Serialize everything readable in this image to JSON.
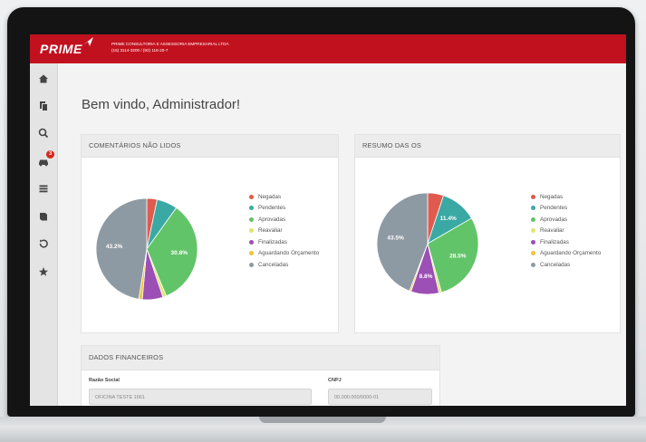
{
  "header": {
    "logo_text": "PRIME",
    "company_name": "PRIME CONSULTORIA E ASSESSORIA EMPRESARIAL LTDA",
    "company_phone": "(15) 3114-3200 / (92) 116-20-7",
    "brand_color": "#c2111e"
  },
  "sidebar": {
    "items": [
      {
        "icon": "home-icon"
      },
      {
        "icon": "documents-icon"
      },
      {
        "icon": "search-icon"
      },
      {
        "icon": "car-icon",
        "badge": "3"
      },
      {
        "icon": "list-icon"
      },
      {
        "icon": "book-icon"
      },
      {
        "icon": "history-icon"
      },
      {
        "icon": "star-icon"
      }
    ]
  },
  "welcome": "Bem vindo, Administrador!",
  "panels": {
    "comments": {
      "title": "COMENTÁRIOS NÃO LIDOS",
      "chart_data": {
        "type": "pie",
        "labels": [
          "Negadas",
          "Pendentes",
          "Aprovadas",
          "Reavaliar",
          "Finalizadas",
          "Aguardando Orçamento",
          "Canceladas"
        ],
        "values": [
          3.0,
          6.0,
          30.8,
          1.0,
          6.0,
          1.0,
          43.2
        ],
        "colors": [
          "#e05a4e",
          "#3aa9a3",
          "#62c468",
          "#e2e56b",
          "#9c4fb4",
          "#f1c43a",
          "#8e9aa3"
        ],
        "data_labels": {
          "Aprovadas": "30.8%",
          "Canceladas": "43.2%"
        }
      }
    },
    "os_summary": {
      "title": "RESUMO DAS OS",
      "chart_data": {
        "type": "pie",
        "labels": [
          "Negadas",
          "Pendentes",
          "Aprovadas",
          "Reavaliar",
          "Finalizadas",
          "Aguardando Orçamento",
          "Canceladas"
        ],
        "values": [
          5.0,
          11.4,
          28.5,
          0.8,
          8.8,
          0.5,
          43.5
        ],
        "colors": [
          "#e05a4e",
          "#3aa9a3",
          "#62c468",
          "#e2e56b",
          "#9c4fb4",
          "#f1c43a",
          "#8e9aa3"
        ],
        "data_labels": {
          "Pendentes": "11.4%",
          "Aprovadas": "28.5%",
          "Finalizadas": "8.8%",
          "Canceladas": "43.5%"
        }
      }
    },
    "financial": {
      "title": "DADOS FINANCEIROS",
      "razao_label": "Razão Social",
      "razao_value": "OFICINA TESTE 1661",
      "cnpj_label": "CNPJ",
      "cnpj_value": "00.000.000/0000-01"
    }
  }
}
